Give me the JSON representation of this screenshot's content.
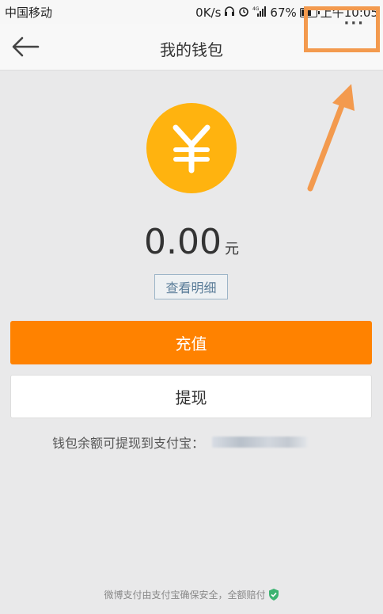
{
  "status_bar": {
    "carrier": "中国移动",
    "network_speed": "0K/s",
    "battery_percent": "67%",
    "time": "上午10:05"
  },
  "navbar": {
    "title": "我的钱包",
    "more": "···"
  },
  "wallet": {
    "currency_symbol": "¥",
    "balance": "0.00",
    "unit": "元",
    "detail_link": "查看明细"
  },
  "actions": {
    "recharge": "充值",
    "withdraw": "提现"
  },
  "withdraw_hint": {
    "text": "钱包余额可提现到支付宝："
  },
  "footer": {
    "text": "微博支付由支付宝确保安全，全额赔付"
  },
  "colors": {
    "accent": "#ff8200",
    "coin": "#ffb30f",
    "highlight_box": "#f39a4e",
    "shield": "#3cb371"
  }
}
